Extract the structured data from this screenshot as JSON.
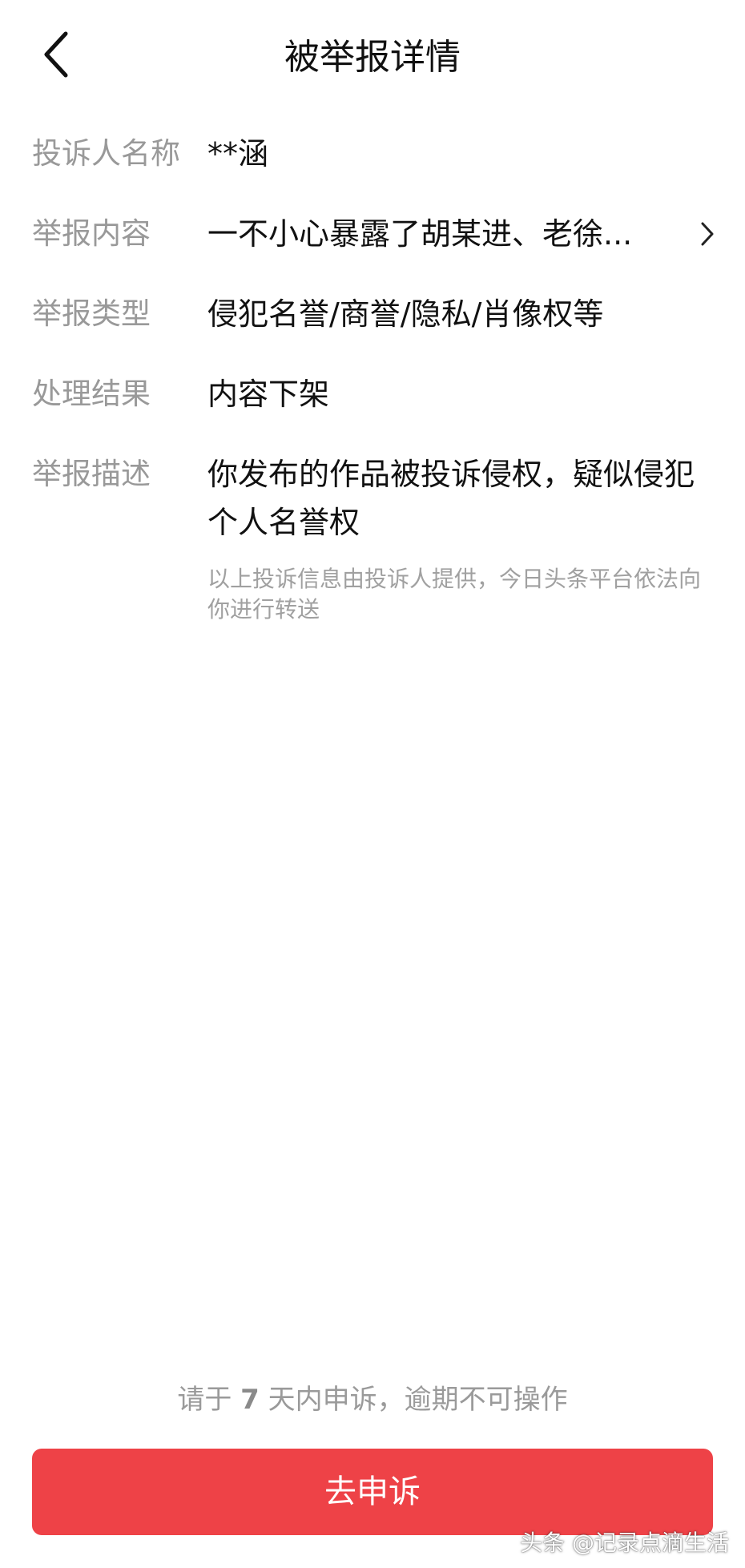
{
  "header": {
    "title": "被举报详情",
    "back_icon": "chevron-left-icon"
  },
  "details": {
    "complainant": {
      "label": "投诉人名称",
      "value": "**涵"
    },
    "content": {
      "label": "举报内容",
      "value": "一不小心暴露了胡某进、老徐...",
      "icon": "chevron-right-icon"
    },
    "type": {
      "label": "举报类型",
      "value": "侵犯名誉/商誉/隐私/肖像权等"
    },
    "result": {
      "label": "处理结果",
      "value": "内容下架"
    },
    "description": {
      "label": "举报描述",
      "value": "你发布的作品被投诉侵权，疑似侵犯个人名誉权",
      "note": "以上投诉信息由投诉人提供，今日头条平台依法向你进行转送"
    }
  },
  "footer": {
    "deadline_prefix": "请于 ",
    "deadline_days": "7",
    "deadline_suffix": " 天内申诉，逾期不可操作",
    "appeal_button": "去申诉",
    "watermark": "头条 @记录点滴生活"
  },
  "colors": {
    "accent": "#ee4247",
    "label_gray": "#999999",
    "text_dark": "#111111"
  }
}
